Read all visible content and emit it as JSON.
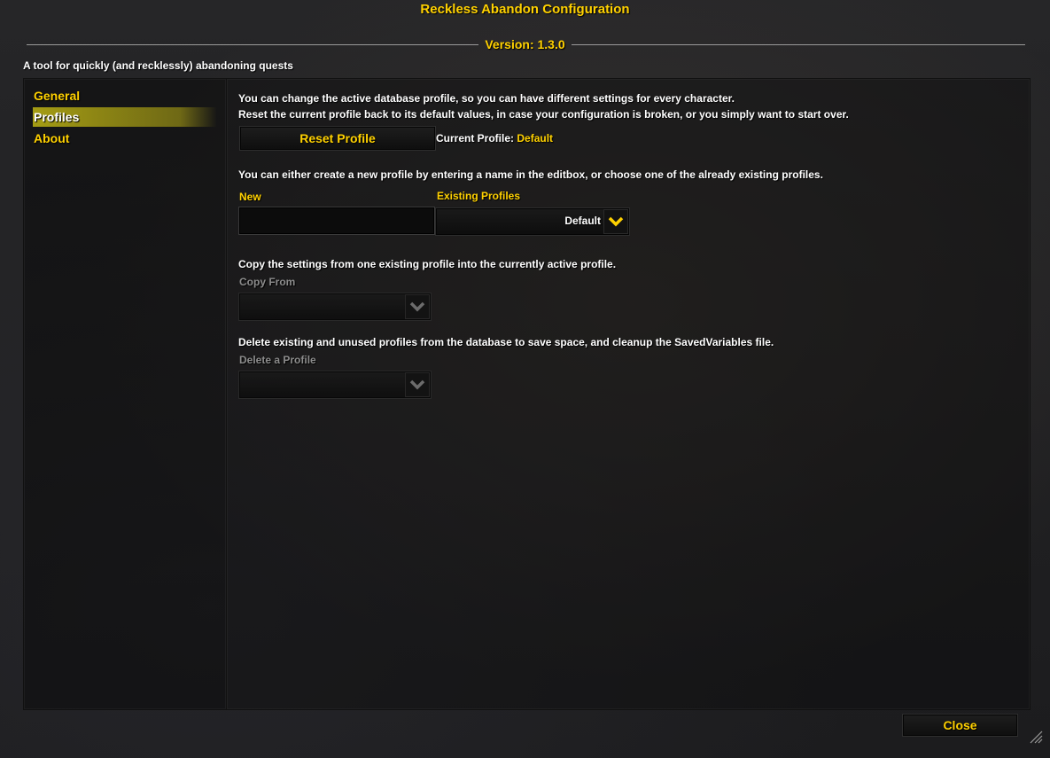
{
  "window": {
    "title": "Reckless Abandon Configuration",
    "version": "Version: 1.3.0",
    "description": "A tool for quickly (and recklessly) abandoning quests",
    "close_label": "Close"
  },
  "sidebar": {
    "items": [
      {
        "label": "General",
        "selected": false
      },
      {
        "label": "Profiles",
        "selected": true
      },
      {
        "label": "About",
        "selected": false
      }
    ]
  },
  "profiles": {
    "intro_line1": "You can change the active database profile, so you can have different settings for every character.",
    "intro_line2": "Reset the current profile back to its default values, in case your configuration is broken, or you simply want to start over.",
    "reset_label": "Reset Profile",
    "current_label": "Current Profile:",
    "current_value": "Default",
    "choose_text": "You can either create a new profile by entering a name in the editbox, or choose one of the already existing profiles.",
    "new_label": "New",
    "new_value": "",
    "existing_label": "Existing Profiles",
    "existing_value": "Default",
    "copy_text": "Copy the settings from one existing profile into the currently active profile.",
    "copy_label": "Copy From",
    "copy_value": "",
    "delete_text": "Delete existing and unused profiles from the database to save space, and cleanup the SavedVariables file.",
    "delete_label": "Delete a Profile",
    "delete_value": ""
  },
  "colors": {
    "accent": "#ffd100",
    "text": "#ffffff",
    "disabled": "#8c8c8c",
    "selection": "#beb414"
  }
}
